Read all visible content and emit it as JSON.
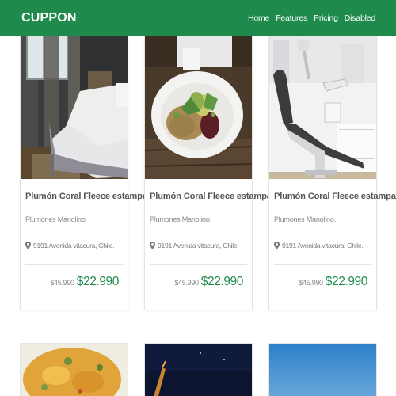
{
  "navbar": {
    "brand": "CUPPON",
    "links": [
      "Home",
      "Features",
      "Pricing",
      "Disabled"
    ]
  },
  "cards": [
    {
      "image": "bedroom-photo",
      "title": "Plumón Coral Fleece estampado",
      "subtitle": "Plumones Manolino.",
      "address": "9191 Avenida vitacura, Chile.",
      "old_price": "$45.990",
      "new_price": "$22.990"
    },
    {
      "image": "salad-bowl-photo",
      "title": "Plumón Coral Fleece estampado",
      "subtitle": "Plumones Manolino.",
      "address": "9191 Avenida vitacura, Chile.",
      "old_price": "$45.990",
      "new_price": "$22.990"
    },
    {
      "image": "dental-chair-photo",
      "title": "Plumón Coral Fleece estampado",
      "subtitle": "Plumones Manolino.",
      "address": "9191 Avenida vitacura, Chile.",
      "old_price": "$45.990",
      "new_price": "$22.990"
    }
  ],
  "second_row_images": [
    "pasta-dish-photo",
    "night-sky-photo",
    "blue-sky-photo"
  ],
  "colors": {
    "primary": "#1e8a4c",
    "price": "#1e8a4c"
  }
}
